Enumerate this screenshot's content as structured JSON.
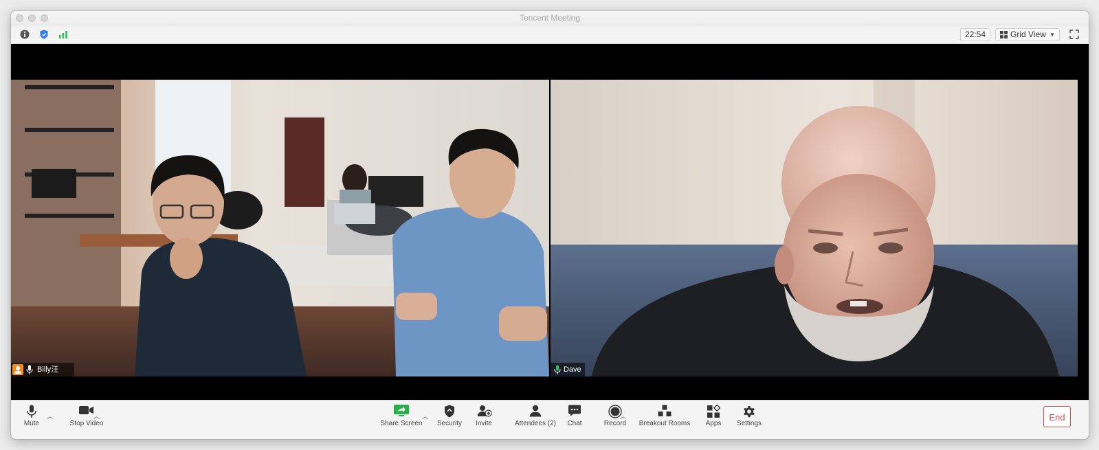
{
  "window": {
    "title": "Tencent Meeting"
  },
  "infobar": {
    "info_icon": "info-icon",
    "shield_icon": "shield-icon",
    "signal_icon": "signal-bars-icon",
    "clock": "22:54",
    "view_mode": "Grid View"
  },
  "participants": [
    {
      "name": "Billy汪",
      "host": true,
      "mic": "on"
    },
    {
      "name": "Dave",
      "host": false,
      "mic": "active",
      "active_speaker": true
    }
  ],
  "toolbar": {
    "mute": "Mute",
    "stop_video": "Stop Video",
    "share_screen": "Share Screen",
    "security": "Security",
    "invite": "Invite",
    "attendees": "Attendees (2)",
    "chat": "Chat",
    "record": "Record",
    "breakout_rooms": "Breakout Rooms",
    "apps": "Apps",
    "settings": "Settings",
    "end": "End"
  },
  "colors": {
    "active_speaker_border": "#2fc25b",
    "end_button": "#e04a4a",
    "share_screen_green": "#27b04a",
    "security_blue": "#2f7cf6"
  }
}
